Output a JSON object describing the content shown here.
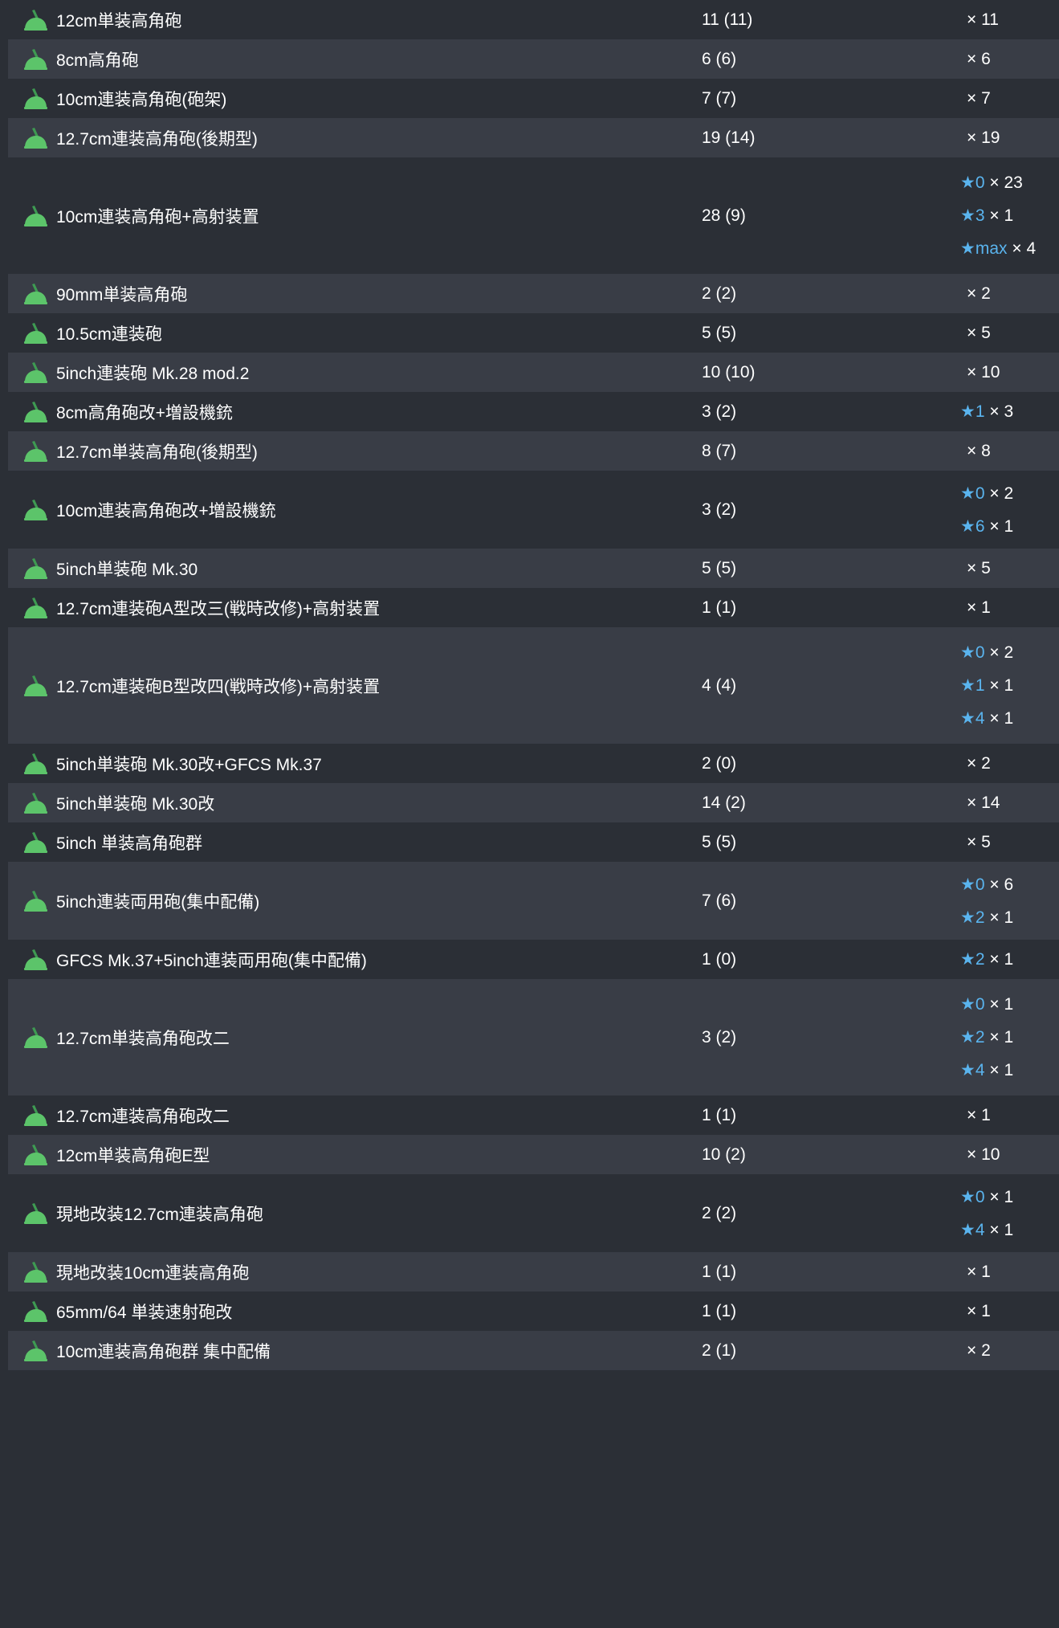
{
  "colors": {
    "row_dark": "#2b2f36",
    "row_light": "#393d46",
    "icon_green": "#5cc46a",
    "icon_stem": "#3e9a52",
    "star_blue": "#5ab4ee",
    "text": "#ffffff"
  },
  "icon_semantic": "anti-air-gun-icon",
  "rows": [
    {
      "name": "12cm単装高角砲",
      "count": "11 (11)",
      "levels": [
        {
          "star": "",
          "qty": "× 11"
        }
      ]
    },
    {
      "name": "8cm高角砲",
      "count": "6 (6)",
      "levels": [
        {
          "star": "",
          "qty": "× 6"
        }
      ]
    },
    {
      "name": "10cm連装高角砲(砲架)",
      "count": "7 (7)",
      "levels": [
        {
          "star": "",
          "qty": "× 7"
        }
      ]
    },
    {
      "name": "12.7cm連装高角砲(後期型)",
      "count": "19 (14)",
      "levels": [
        {
          "star": "",
          "qty": "× 19"
        }
      ]
    },
    {
      "name": "10cm連装高角砲+高射装置",
      "count": "28 (9)",
      "levels": [
        {
          "star": "★0",
          "qty": "× 23"
        },
        {
          "star": "★3",
          "qty": "× 1"
        },
        {
          "star": "★max",
          "qty": "× 4"
        }
      ]
    },
    {
      "name": "90mm単装高角砲",
      "count": "2 (2)",
      "levels": [
        {
          "star": "",
          "qty": "× 2"
        }
      ]
    },
    {
      "name": "10.5cm連装砲",
      "count": "5 (5)",
      "levels": [
        {
          "star": "",
          "qty": "× 5"
        }
      ]
    },
    {
      "name": "5inch連装砲 Mk.28 mod.2",
      "count": "10 (10)",
      "levels": [
        {
          "star": "",
          "qty": "× 10"
        }
      ]
    },
    {
      "name": "8cm高角砲改+増設機銃",
      "count": "3 (2)",
      "levels": [
        {
          "star": "★1",
          "qty": "× 3"
        }
      ]
    },
    {
      "name": "12.7cm単装高角砲(後期型)",
      "count": "8 (7)",
      "levels": [
        {
          "star": "",
          "qty": "× 8"
        }
      ]
    },
    {
      "name": "10cm連装高角砲改+増設機銃",
      "count": "3 (2)",
      "levels": [
        {
          "star": "★0",
          "qty": "× 2"
        },
        {
          "star": "★6",
          "qty": "× 1"
        }
      ]
    },
    {
      "name": "5inch単装砲 Mk.30",
      "count": "5 (5)",
      "levels": [
        {
          "star": "",
          "qty": "× 5"
        }
      ]
    },
    {
      "name": "12.7cm連装砲A型改三(戦時改修)+高射装置",
      "count": "1 (1)",
      "levels": [
        {
          "star": "",
          "qty": "× 1"
        }
      ]
    },
    {
      "name": "12.7cm連装砲B型改四(戦時改修)+高射装置",
      "count": "4 (4)",
      "levels": [
        {
          "star": "★0",
          "qty": "× 2"
        },
        {
          "star": "★1",
          "qty": "× 1"
        },
        {
          "star": "★4",
          "qty": "× 1"
        }
      ]
    },
    {
      "name": "5inch単装砲 Mk.30改+GFCS Mk.37",
      "count": "2 (0)",
      "levels": [
        {
          "star": "",
          "qty": "× 2"
        }
      ]
    },
    {
      "name": "5inch単装砲 Mk.30改",
      "count": "14 (2)",
      "levels": [
        {
          "star": "",
          "qty": "× 14"
        }
      ]
    },
    {
      "name": "5inch 単装高角砲群",
      "count": "5 (5)",
      "levels": [
        {
          "star": "",
          "qty": "× 5"
        }
      ]
    },
    {
      "name": "5inch連装両用砲(集中配備)",
      "count": "7 (6)",
      "levels": [
        {
          "star": "★0",
          "qty": "× 6"
        },
        {
          "star": "★2",
          "qty": "× 1"
        }
      ]
    },
    {
      "name": "GFCS Mk.37+5inch連装両用砲(集中配備)",
      "count": "1 (0)",
      "levels": [
        {
          "star": "★2",
          "qty": "× 1"
        }
      ]
    },
    {
      "name": "12.7cm単装高角砲改二",
      "count": "3 (2)",
      "levels": [
        {
          "star": "★0",
          "qty": "× 1"
        },
        {
          "star": "★2",
          "qty": "× 1"
        },
        {
          "star": "★4",
          "qty": "× 1"
        }
      ]
    },
    {
      "name": "12.7cm連装高角砲改二",
      "count": "1 (1)",
      "levels": [
        {
          "star": "",
          "qty": "× 1"
        }
      ]
    },
    {
      "name": "12cm単装高角砲E型",
      "count": "10 (2)",
      "levels": [
        {
          "star": "",
          "qty": "× 10"
        }
      ]
    },
    {
      "name": "現地改装12.7cm連装高角砲",
      "count": "2 (2)",
      "levels": [
        {
          "star": "★0",
          "qty": "× 1"
        },
        {
          "star": "★4",
          "qty": "× 1"
        }
      ]
    },
    {
      "name": "現地改装10cm連装高角砲",
      "count": "1 (1)",
      "levels": [
        {
          "star": "",
          "qty": "× 1"
        }
      ]
    },
    {
      "name": "65mm/64 単装速射砲改",
      "count": "1 (1)",
      "levels": [
        {
          "star": "",
          "qty": "× 1"
        }
      ]
    },
    {
      "name": "10cm連装高角砲群 集中配備",
      "count": "2 (1)",
      "levels": [
        {
          "star": "",
          "qty": "× 2"
        }
      ]
    }
  ]
}
